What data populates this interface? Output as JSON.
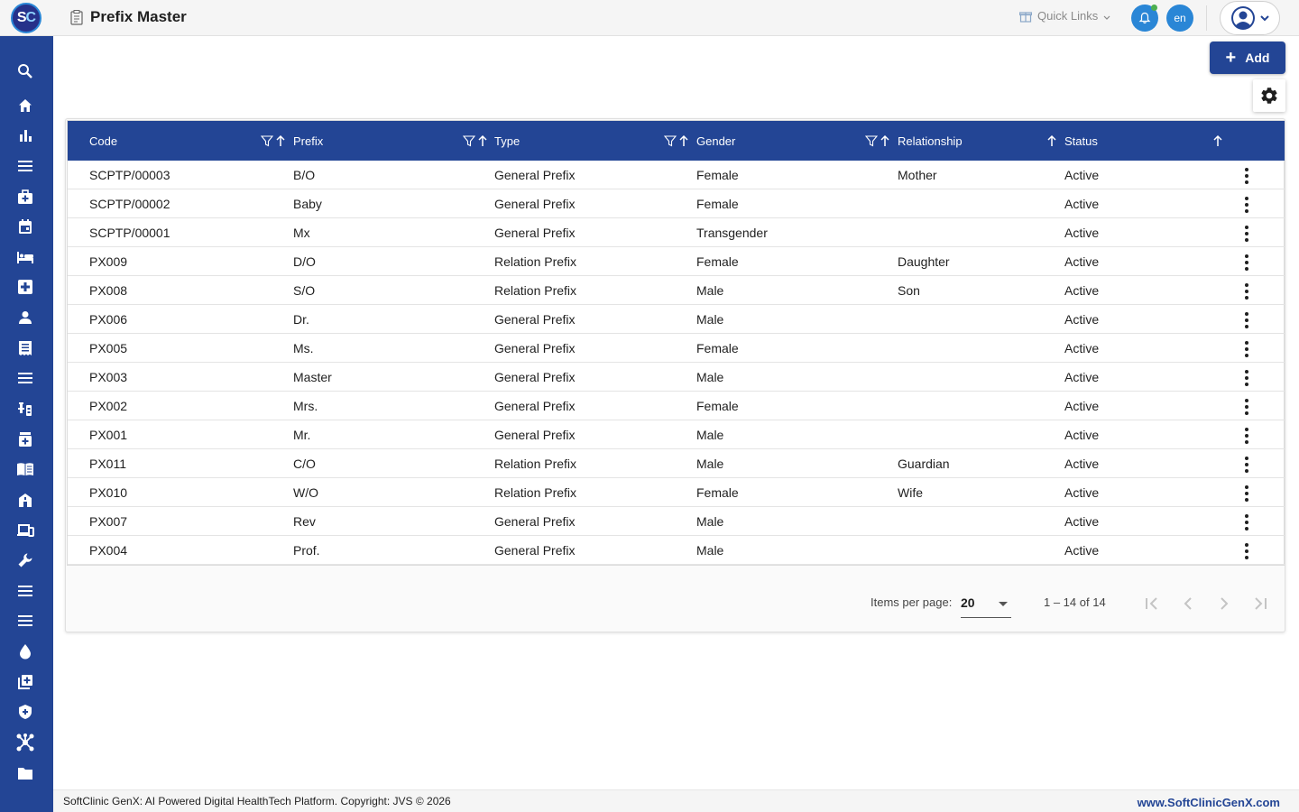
{
  "app": {
    "logo_text_s": "S",
    "logo_text_c": "C",
    "page_title": "Prefix Master"
  },
  "header": {
    "quick_links_label": "Quick Links",
    "language_code": "en"
  },
  "toolbar": {
    "add_label": "Add"
  },
  "table": {
    "columns": [
      "Code",
      "Prefix",
      "Type",
      "Gender",
      "Relationship",
      "Status"
    ],
    "rows": [
      {
        "code": "SCPTP/00003",
        "prefix": "B/O",
        "type": "General Prefix",
        "gender": "Female",
        "relationship": "Mother",
        "status": "Active"
      },
      {
        "code": "SCPTP/00002",
        "prefix": "Baby",
        "type": "General Prefix",
        "gender": "Female",
        "relationship": "",
        "status": "Active"
      },
      {
        "code": "SCPTP/00001",
        "prefix": "Mx",
        "type": "General Prefix",
        "gender": "Transgender",
        "relationship": "",
        "status": "Active"
      },
      {
        "code": "PX009",
        "prefix": "D/O",
        "type": "Relation Prefix",
        "gender": "Female",
        "relationship": "Daughter",
        "status": "Active"
      },
      {
        "code": "PX008",
        "prefix": "S/O",
        "type": "Relation Prefix",
        "gender": "Male",
        "relationship": "Son",
        "status": "Active"
      },
      {
        "code": "PX006",
        "prefix": "Dr.",
        "type": "General Prefix",
        "gender": "Male",
        "relationship": "",
        "status": "Active"
      },
      {
        "code": "PX005",
        "prefix": "Ms.",
        "type": "General Prefix",
        "gender": "Female",
        "relationship": "",
        "status": "Active"
      },
      {
        "code": "PX003",
        "prefix": "Master",
        "type": "General Prefix",
        "gender": "Male",
        "relationship": "",
        "status": "Active"
      },
      {
        "code": "PX002",
        "prefix": "Mrs.",
        "type": "General Prefix",
        "gender": "Female",
        "relationship": "",
        "status": "Active"
      },
      {
        "code": "PX001",
        "prefix": "Mr.",
        "type": "General Prefix",
        "gender": "Male",
        "relationship": "",
        "status": "Active"
      },
      {
        "code": "PX011",
        "prefix": "C/O",
        "type": "Relation Prefix",
        "gender": "Male",
        "relationship": "Guardian",
        "status": "Active"
      },
      {
        "code": "PX010",
        "prefix": "W/O",
        "type": "Relation Prefix",
        "gender": "Female",
        "relationship": "Wife",
        "status": "Active"
      },
      {
        "code": "PX007",
        "prefix": "Rev",
        "type": "General Prefix",
        "gender": "Male",
        "relationship": "",
        "status": "Active"
      },
      {
        "code": "PX004",
        "prefix": "Prof.",
        "type": "General Prefix",
        "gender": "Male",
        "relationship": "",
        "status": "Active"
      }
    ]
  },
  "paginator": {
    "items_per_page_label": "Items per page:",
    "items_per_page_value": "20",
    "range_label": "1 – 14 of 14"
  },
  "sidebar": {
    "icons": [
      "search-icon",
      "home-icon",
      "bar-chart-icon",
      "menu-icon",
      "medical-bag-icon",
      "calendar-icon",
      "bed-icon",
      "medical-plus-icon",
      "person-icon",
      "receipt-icon",
      "list-icon",
      "lab-icon",
      "medicine-box-icon",
      "book-icon",
      "building-icon",
      "devices-icon",
      "wrench-icon",
      "list-icon",
      "list-icon",
      "blood-drop-icon",
      "add-library-icon",
      "shield-icon",
      "hub-icon",
      "folder-icon"
    ]
  },
  "footer": {
    "copyright": "SoftClinic GenX: AI Powered Digital HealthTech Platform. Copyright: JVS © 2026",
    "website": "www.SoftClinicGenX.com"
  },
  "colors": {
    "primary": "#234595",
    "accent": "#2a86d6",
    "notification_dot": "#4caf50"
  }
}
